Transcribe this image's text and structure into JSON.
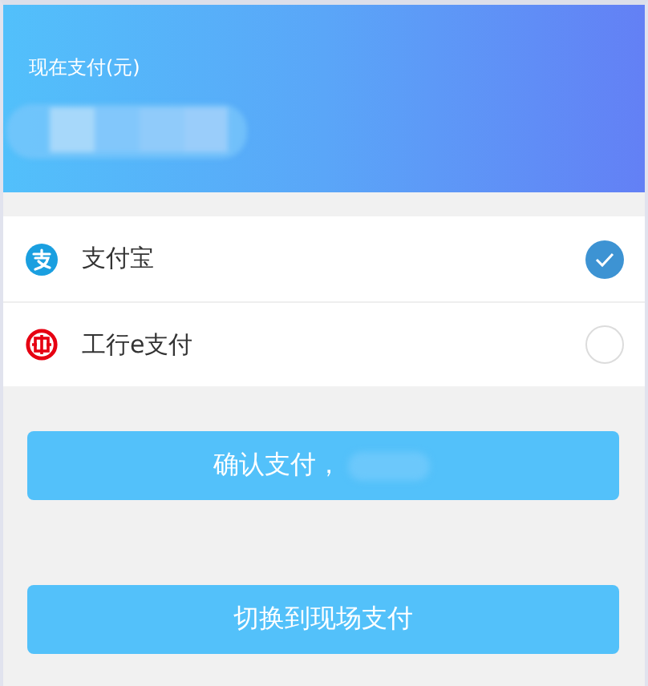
{
  "header": {
    "label": "现在支付(元)"
  },
  "payment_methods": [
    {
      "name": "支付宝",
      "kind": "wallet",
      "selected": true
    },
    {
      "name": "工行e支付",
      "kind": "bank",
      "selected": false
    }
  ],
  "buttons": [
    {
      "label": "确认支付，",
      "kind": "confirm"
    },
    {
      "label": "切换到现场支付",
      "kind": "switch"
    }
  ]
}
